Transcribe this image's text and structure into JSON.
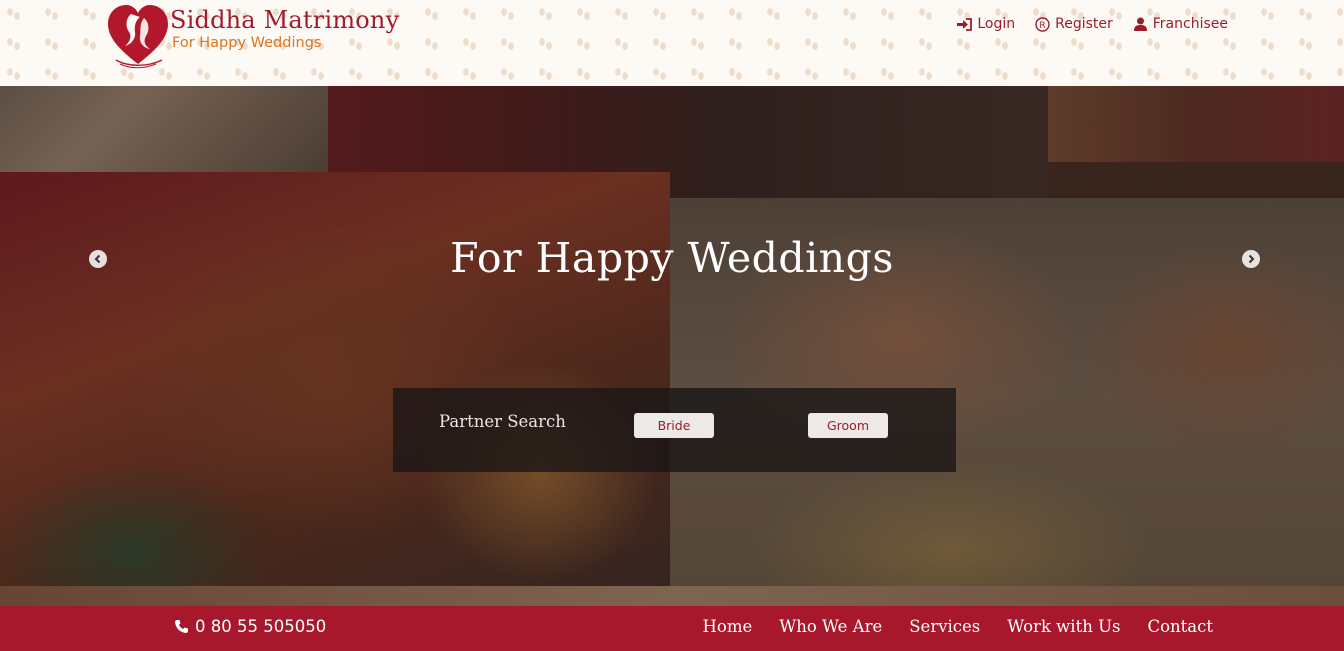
{
  "brand": {
    "name": "Siddha Matrimony",
    "tagline": "For Happy Weddings",
    "primary_color": "#9e1b2c",
    "tagline_color": "#e0741c"
  },
  "top_links": [
    {
      "label": "Login",
      "icon": "sign-in-icon"
    },
    {
      "label": "Register",
      "icon": "registered-icon"
    },
    {
      "label": "Franchisee",
      "icon": "user-icon"
    }
  ],
  "hero": {
    "title": "For Happy Weddings",
    "prev_icon": "chevron-left-icon",
    "next_icon": "chevron-right-icon"
  },
  "search": {
    "label": "Partner Search",
    "bride_label": "Bride",
    "groom_label": "Groom"
  },
  "footer_nav": {
    "phone": "0 80 55 505050",
    "phone_icon": "phone-icon",
    "bar_color": "#a8182c",
    "links": [
      "Home",
      "Who We Are",
      "Services",
      "Work with Us",
      "Contact"
    ]
  }
}
